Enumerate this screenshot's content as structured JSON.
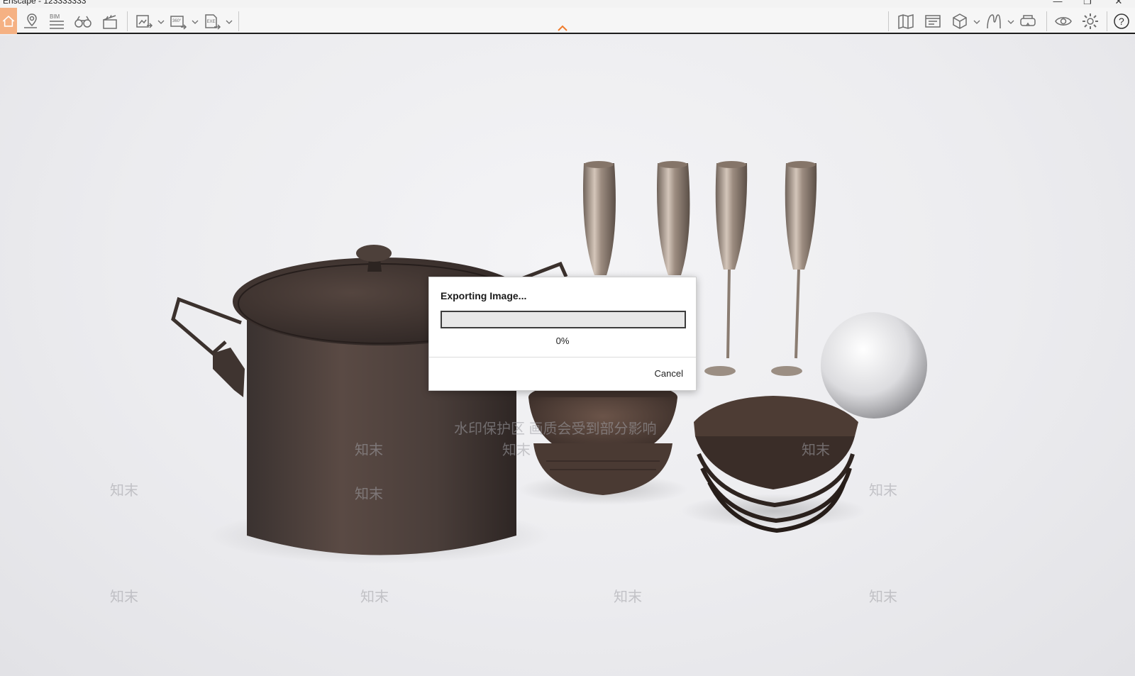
{
  "window": {
    "title": "Enscape - 123333333",
    "minimize": "—",
    "restore": "❐",
    "close": "✕"
  },
  "toolbar": {
    "left_icons": [
      "home-icon",
      "map-pin-icon",
      "bim-icon",
      "binoculars-icon",
      "clapper-icon",
      "batch-render-icon",
      "panorama-360-icon",
      "export-exe-icon"
    ],
    "bim_label": "BIM",
    "pano_label": "360°",
    "exe_label": "EXE",
    "right_icons": [
      "site-map-icon",
      "asset-library-icon",
      "cube-icon",
      "material-editor-icon",
      "vr-headset-icon",
      "view-eye-icon",
      "settings-gear-icon",
      "help-icon"
    ],
    "help_label": "?",
    "accent": "#f07c2c",
    "home_bg": "#f5b183"
  },
  "watermark": {
    "line": "水印保护区   画质会受到部分影响",
    "brand": "知末"
  },
  "dialog": {
    "title": "Exporting Image...",
    "progress": 0,
    "progress_text": "0%",
    "cancel": "Cancel"
  }
}
